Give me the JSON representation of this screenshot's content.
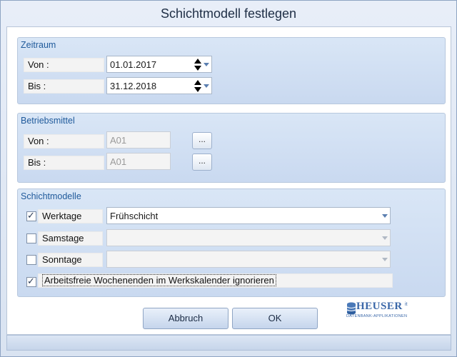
{
  "window": {
    "title": "Schichtmodell festlegen"
  },
  "zeitraum": {
    "title": "Zeitraum",
    "von_label": "Von :",
    "von_value": "01.01.2017",
    "bis_label": "Bis :",
    "bis_value": "31.12.2018"
  },
  "betriebsmittel": {
    "title": "Betriebsmittel",
    "von_label": "Von :",
    "von_value": "A01",
    "bis_label": "Bis :",
    "bis_value": "A01",
    "browse_label": "..."
  },
  "schichtmodelle": {
    "title": "Schichtmodelle",
    "werktage": {
      "label": "Werktage",
      "checked": true,
      "value": "Frühschicht"
    },
    "samstage": {
      "label": "Samstage",
      "checked": false,
      "value": ""
    },
    "sonntage": {
      "label": "Sonntage",
      "checked": false,
      "value": ""
    },
    "ignore": {
      "label": "Arbeitsfreie Wochenenden im Werkskalender ignorieren",
      "checked": true
    }
  },
  "buttons": {
    "cancel": "Abbruch",
    "ok": "OK"
  },
  "logo": {
    "brand": "HEUSER",
    "suffix": "it",
    "tagline": "DATENBANK-APPLIKATIONEN"
  },
  "colors": {
    "group_title": "#1f5a9b",
    "accent": "#5b7fb0"
  }
}
